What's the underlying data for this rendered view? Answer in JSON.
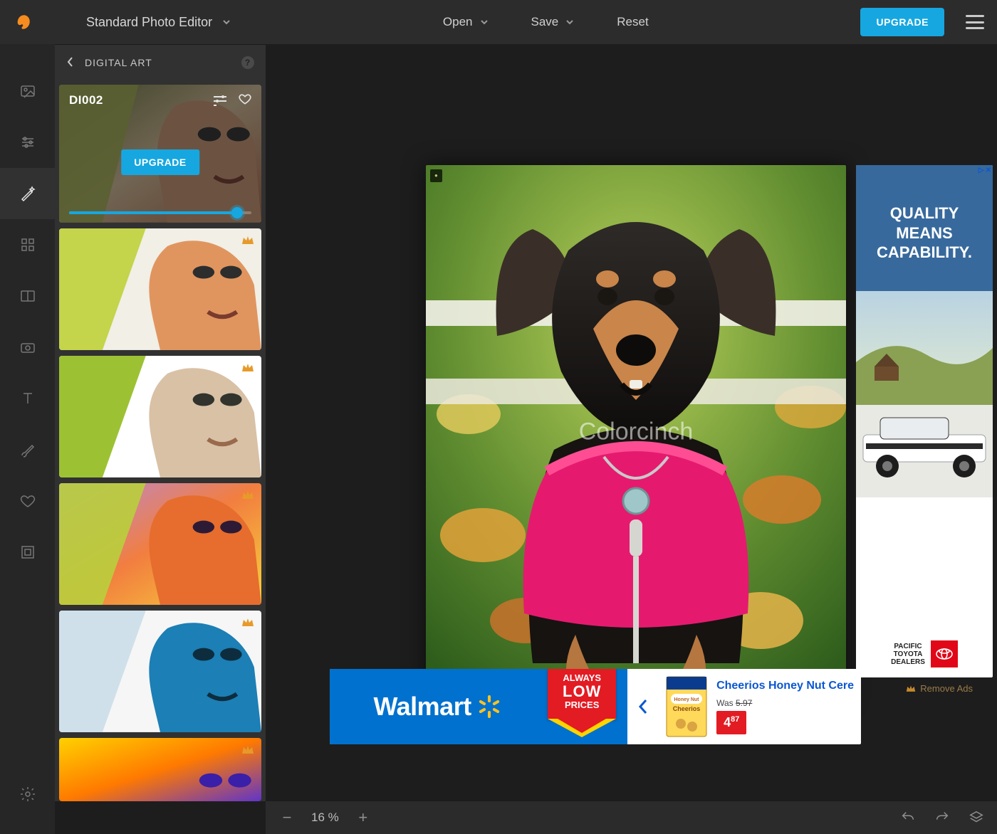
{
  "header": {
    "app_title": "Standard Photo Editor",
    "open_label": "Open",
    "save_label": "Save",
    "reset_label": "Reset",
    "upgrade_label": "UPGRADE"
  },
  "left_rail": {
    "items": [
      {
        "name": "image-tool-icon"
      },
      {
        "name": "sliders-tool-icon"
      },
      {
        "name": "magic-wand-icon"
      },
      {
        "name": "grid-tool-icon"
      },
      {
        "name": "compare-tool-icon"
      },
      {
        "name": "capture-tool-icon"
      },
      {
        "name": "text-tool-icon"
      },
      {
        "name": "brush-tool-icon"
      },
      {
        "name": "heart-tool-icon"
      },
      {
        "name": "frame-tool-icon"
      }
    ],
    "active_index": 2,
    "settings_name": "settings-icon"
  },
  "sidebar": {
    "title": "DIGITAL ART",
    "selected": {
      "label": "DI002",
      "upgrade_label": "UPGRADE",
      "slider_percent": 92
    },
    "thumbs": [
      {
        "premium": true
      },
      {
        "premium": true
      },
      {
        "premium": true
      },
      {
        "premium": true
      },
      {
        "premium": true
      }
    ]
  },
  "canvas": {
    "watermark": "Colorcinch"
  },
  "ad_sky": {
    "line1": "QUALITY",
    "line2": "MEANS",
    "line3": "CAPABILITY.",
    "dealer1": "PACIFIC",
    "dealer2": "TOYOTA",
    "dealer3": "DEALERS"
  },
  "remove_ads_label": "Remove Ads",
  "ad_banner": {
    "brand": "Walmart",
    "ribbon_top": "ALWAYS",
    "ribbon_mid": "LOW",
    "ribbon_bot": "PRICES",
    "product_name": "Cheerios Honey Nut Cere",
    "was_label": "Was",
    "was_price": "5.97",
    "price_whole": "4",
    "price_cents": "87"
  },
  "statusbar": {
    "zoom_label": "16 %"
  }
}
